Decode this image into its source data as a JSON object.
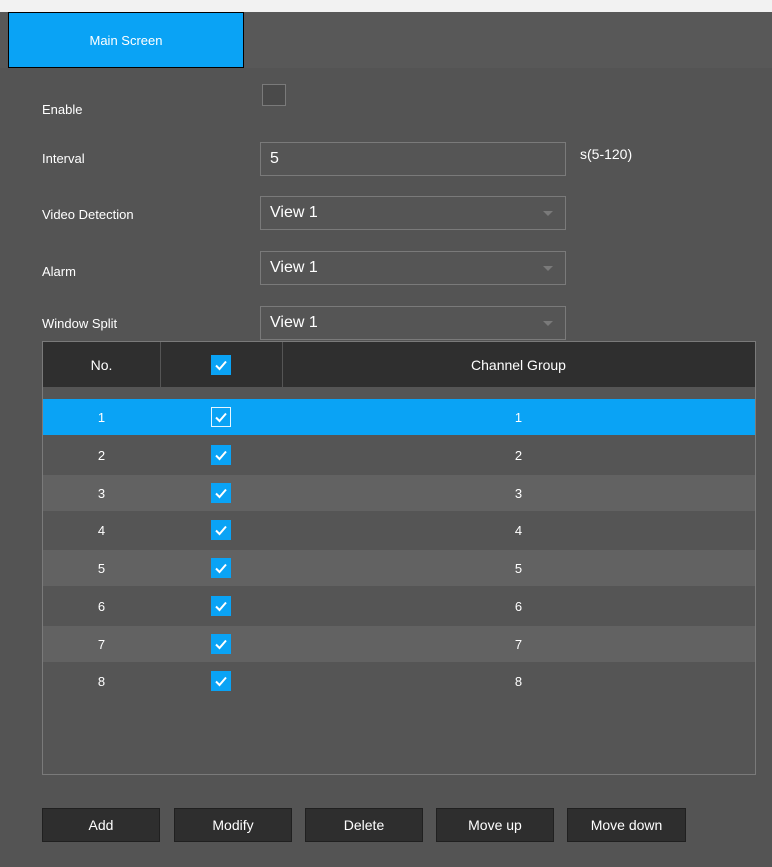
{
  "tabs": [
    {
      "label": "Main Screen",
      "active": true
    }
  ],
  "form": {
    "enable_label": "Enable",
    "enable_checked": false,
    "interval_label": "Interval",
    "interval_value": "5",
    "interval_unit": "s(5-120)",
    "video_detection_label": "Video Detection",
    "video_detection_value": "View 1",
    "alarm_label": "Alarm",
    "alarm_value": "View 1",
    "window_split_label": "Window Split",
    "window_split_value": "View 1"
  },
  "table": {
    "headers": [
      "No.",
      "Channel Group"
    ],
    "header_checkbox_checked": true,
    "selected_row": 1,
    "rows": [
      {
        "no": "1",
        "checked": true,
        "group": "1"
      },
      {
        "no": "2",
        "checked": true,
        "group": "2"
      },
      {
        "no": "3",
        "checked": true,
        "group": "3"
      },
      {
        "no": "4",
        "checked": true,
        "group": "4"
      },
      {
        "no": "5",
        "checked": true,
        "group": "5"
      },
      {
        "no": "6",
        "checked": true,
        "group": "6"
      },
      {
        "no": "7",
        "checked": true,
        "group": "7"
      },
      {
        "no": "8",
        "checked": true,
        "group": "8"
      }
    ]
  },
  "buttons": {
    "add": "Add",
    "modify": "Modify",
    "delete": "Delete",
    "move_up": "Move up",
    "move_down": "Move down"
  },
  "colors": {
    "accent": "#0aa3f5",
    "panel": "#545454",
    "header": "#2f2f2f"
  }
}
